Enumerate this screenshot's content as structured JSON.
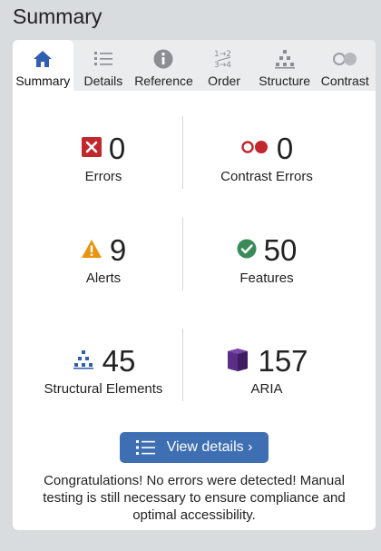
{
  "header": {
    "title": "Summary"
  },
  "tabs": [
    {
      "label": "Summary",
      "icon": "home-icon",
      "active": true
    },
    {
      "label": "Details",
      "icon": "list-icon",
      "active": false
    },
    {
      "label": "Reference",
      "icon": "info-icon",
      "active": false
    },
    {
      "label": "Order",
      "icon": "order-icon",
      "active": false
    },
    {
      "label": "Structure",
      "icon": "structure-icon",
      "active": false
    },
    {
      "label": "Contrast",
      "icon": "contrast-icon",
      "active": false
    }
  ],
  "stats": {
    "errors": {
      "value": "0",
      "label": "Errors",
      "icon": "error-icon"
    },
    "contrast_errors": {
      "value": "0",
      "label": "Contrast Errors",
      "icon": "contrast-error-icon"
    },
    "alerts": {
      "value": "9",
      "label": "Alerts",
      "icon": "alert-icon"
    },
    "features": {
      "value": "50",
      "label": "Features",
      "icon": "feature-icon"
    },
    "structural": {
      "value": "45",
      "label": "Structural Elements",
      "icon": "structure-icon"
    },
    "aria": {
      "value": "157",
      "label": "ARIA",
      "icon": "aria-icon"
    }
  },
  "actions": {
    "view_details_label": "View details ›"
  },
  "message": "Congratulations! No errors were detected! Manual testing is still necessary to ensure compliance and optimal accessibility.",
  "colors": {
    "accent": "#3f6fb3",
    "error": "#c1272d",
    "alert": "#e8940e",
    "feature": "#3a8b5a",
    "structure": "#2f5fae",
    "aria": "#5b2d86"
  }
}
